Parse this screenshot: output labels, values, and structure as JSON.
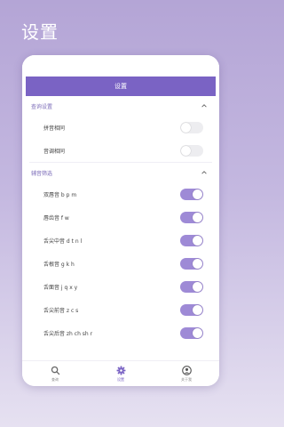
{
  "page": {
    "title": "设置"
  },
  "app": {
    "header_title": "设置"
  },
  "sections": [
    {
      "label": "查询设置",
      "items": [
        {
          "label": "拼音相同",
          "on": false
        },
        {
          "label": "音调相同",
          "on": false
        }
      ]
    },
    {
      "label": "辅音筛选",
      "items": [
        {
          "label": "双唇音 b p m",
          "on": true
        },
        {
          "label": "唇齿音 f w",
          "on": true
        },
        {
          "label": "舌尖中音 d t n l",
          "on": true
        },
        {
          "label": "舌根音 g k h",
          "on": true
        },
        {
          "label": "舌面音 j q x y",
          "on": true
        },
        {
          "label": "舌尖前音 z c s",
          "on": true
        },
        {
          "label": "舌尖后音 zh ch sh r",
          "on": true
        }
      ]
    }
  ],
  "bottom_nav": [
    {
      "label": "查询",
      "icon": "search-icon"
    },
    {
      "label": "设置",
      "icon": "gear-icon"
    },
    {
      "label": "关于我",
      "icon": "user-icon"
    }
  ],
  "colors": {
    "accent": "#7a63c4",
    "toggle_on": "#9e8ad6",
    "toggle_off": "#ededf0"
  }
}
